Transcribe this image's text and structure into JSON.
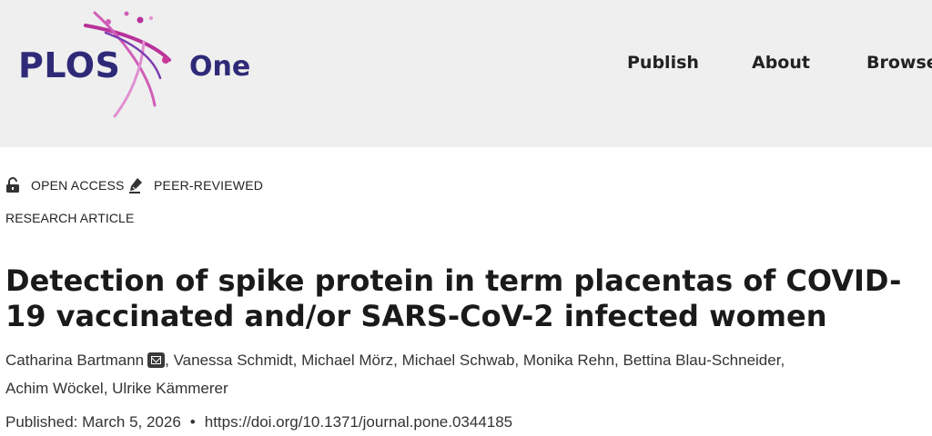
{
  "header": {
    "logo": {
      "text_plos": "PLOS",
      "text_one": "One",
      "brand_color": "#2f2a78",
      "accent_color": "#c9399a"
    },
    "nav": [
      {
        "label": "Publish"
      },
      {
        "label": "About"
      },
      {
        "label": "Browse"
      }
    ]
  },
  "badges": [
    {
      "label": "OPEN ACCESS",
      "icon": "unlocked-padlock-icon"
    },
    {
      "label": "PEER-REVIEWED",
      "icon": "peer-reviewed-pen-icon"
    }
  ],
  "article": {
    "type": "RESEARCH ARTICLE",
    "title": "Detection of spike protein in term placentas of COVID-19 vaccinated and/or SARS-CoV-2 infected women",
    "authors": [
      {
        "name": "Catharina Bartmann",
        "icon": "email-icon"
      },
      {
        "name": "Vanessa Schmidt"
      },
      {
        "name": "Michael Mörz"
      },
      {
        "name": "Michael Schwab"
      },
      {
        "name": "Monika Rehn"
      },
      {
        "name": "Bettina Blau-Schneider"
      },
      {
        "name": "Achim Wöckel"
      },
      {
        "name": "Ulrike Kämmerer"
      }
    ],
    "published_label": "Published: March 5, 2026",
    "bullet": "•",
    "doi": "https://doi.org/10.1371/journal.pone.0344185"
  }
}
